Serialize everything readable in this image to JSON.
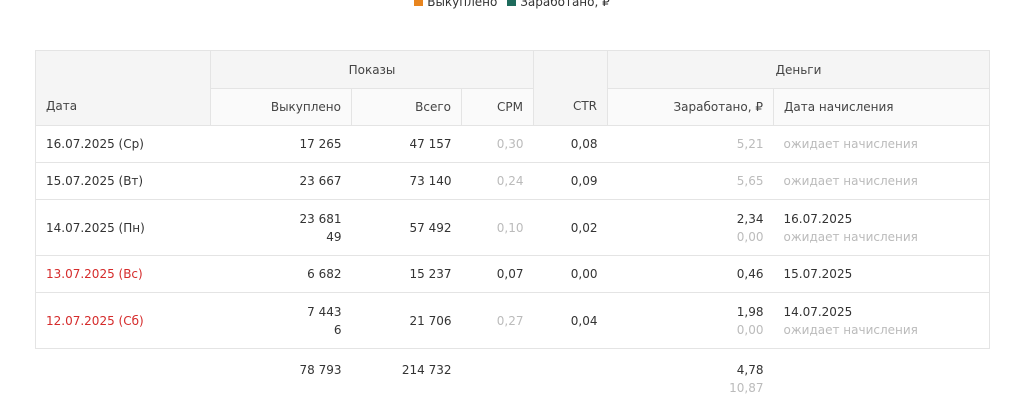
{
  "legend": [
    {
      "label": "Выкуплено",
      "color": "#e8851f"
    },
    {
      "label": "Заработано, ₽",
      "color": "#1e6b5c"
    }
  ],
  "table": {
    "headers": {
      "date": "Дата",
      "shows_group": "Показы",
      "money_group": "Деньги",
      "bought": "Выкуплено",
      "total": "Всего",
      "cpm": "CPM",
      "ctr": "CTR",
      "earned": "Заработано, ₽",
      "accrual_date": "Дата начисления"
    },
    "rows": [
      {
        "date": "16.07.2025 (Ср)",
        "weekend": false,
        "bought": [
          "17 265"
        ],
        "total": "47 157",
        "cpm": "0,30",
        "cpm_muted": true,
        "ctr": "0,08",
        "earned": [
          {
            "v": "5,21",
            "muted": true
          }
        ],
        "accrual": [
          {
            "v": "ожидает начисления",
            "muted": true
          }
        ]
      },
      {
        "date": "15.07.2025 (Вт)",
        "weekend": false,
        "bought": [
          "23 667"
        ],
        "total": "73 140",
        "cpm": "0,24",
        "cpm_muted": true,
        "ctr": "0,09",
        "earned": [
          {
            "v": "5,65",
            "muted": true
          }
        ],
        "accrual": [
          {
            "v": "ожидает начисления",
            "muted": true
          }
        ]
      },
      {
        "date": "14.07.2025 (Пн)",
        "weekend": false,
        "bought": [
          "23 681",
          "49"
        ],
        "total": "57 492",
        "cpm": "0,10",
        "cpm_muted": true,
        "ctr": "0,02",
        "earned": [
          {
            "v": "2,34",
            "muted": false
          },
          {
            "v": "0,00",
            "muted": true
          }
        ],
        "accrual": [
          {
            "v": "16.07.2025",
            "muted": false
          },
          {
            "v": "ожидает начисления",
            "muted": true
          }
        ]
      },
      {
        "date": "13.07.2025 (Вс)",
        "weekend": true,
        "bought": [
          "6 682"
        ],
        "total": "15 237",
        "cpm": "0,07",
        "cpm_muted": false,
        "ctr": "0,00",
        "earned": [
          {
            "v": "0,46",
            "muted": false
          }
        ],
        "accrual": [
          {
            "v": "15.07.2025",
            "muted": false
          }
        ]
      },
      {
        "date": "12.07.2025 (Сб)",
        "weekend": true,
        "bought": [
          "7 443",
          "6"
        ],
        "total": "21 706",
        "cpm": "0,27",
        "cpm_muted": true,
        "ctr": "0,04",
        "earned": [
          {
            "v": "1,98",
            "muted": false
          },
          {
            "v": "0,00",
            "muted": true
          }
        ],
        "accrual": [
          {
            "v": "14.07.2025",
            "muted": false
          },
          {
            "v": "ожидает начисления",
            "muted": true
          }
        ]
      }
    ],
    "totals": {
      "bought": "78 793",
      "total": "214 732",
      "earned": "4,78",
      "earned_pending": "10,87"
    }
  }
}
